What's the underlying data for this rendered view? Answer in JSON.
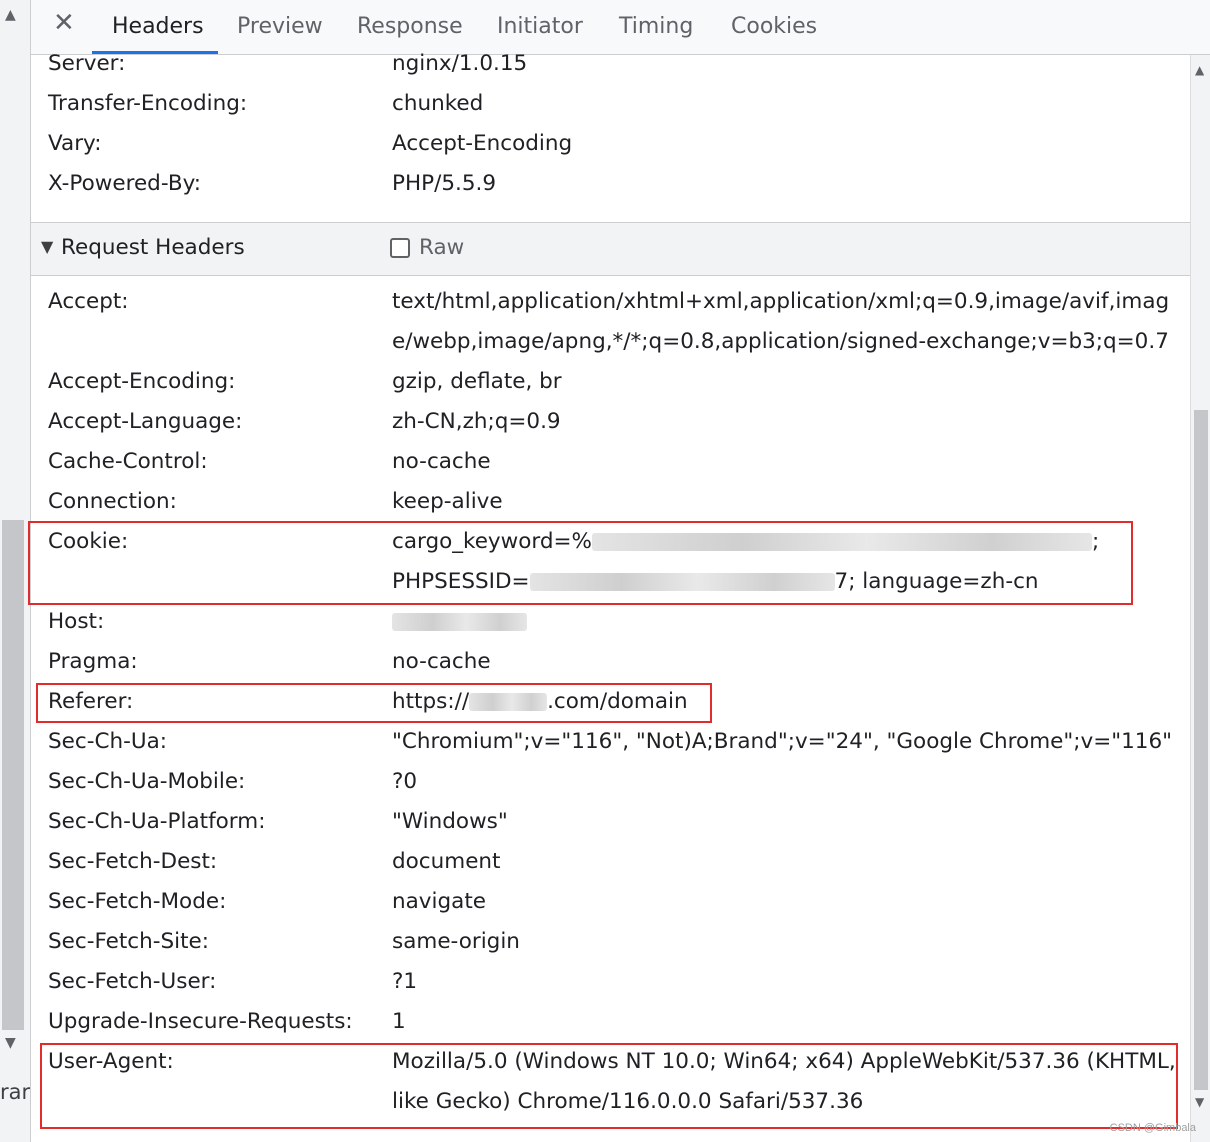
{
  "tabs": [
    {
      "label": "Headers",
      "active": true
    },
    {
      "label": "Preview"
    },
    {
      "label": "Response"
    },
    {
      "label": "Initiator"
    },
    {
      "label": "Timing"
    },
    {
      "label": "Cookies"
    }
  ],
  "left_fragment": "rar",
  "response_headers": [
    {
      "key": "Server:",
      "value": "nginx/1.0.15"
    },
    {
      "key": "Transfer-Encoding:",
      "value": "chunked"
    },
    {
      "key": "Vary:",
      "value": "Accept-Encoding"
    },
    {
      "key": "X-Powered-By:",
      "value": "PHP/5.5.9"
    }
  ],
  "request_section": {
    "title": "Request Headers",
    "raw_label": "Raw",
    "raw_checked": false
  },
  "request_headers": {
    "accept": {
      "key": "Accept:",
      "value": "text/html,application/xhtml+xml,application/xml;q=0.9,image/avif,image/webp,image/apng,*/*;q=0.8,application/signed-exchange;v=b3;q=0.7"
    },
    "accept_encoding": {
      "key": "Accept-Encoding:",
      "value": "gzip, deflate, br"
    },
    "accept_language": {
      "key": "Accept-Language:",
      "value": "zh-CN,zh;q=0.9"
    },
    "cache_control": {
      "key": "Cache-Control:",
      "value": "no-cache"
    },
    "connection": {
      "key": "Connection:",
      "value": "keep-alive"
    },
    "cookie": {
      "key": "Cookie:",
      "line1_prefix": "cargo_keyword=%",
      "line1_suffix": ";",
      "line2_prefix": "PHPSESSID=",
      "line2_suffix": "7; language=zh-cn"
    },
    "host": {
      "key": "Host:"
    },
    "pragma": {
      "key": "Pragma:",
      "value": "no-cache"
    },
    "referer": {
      "key": "Referer:",
      "prefix": "https://",
      "suffix": ".com/domain"
    },
    "sec_ch_ua": {
      "key": "Sec-Ch-Ua:",
      "value": "\"Chromium\";v=\"116\", \"Not)A;Brand\";v=\"24\", \"Google Chrome\";v=\"116\""
    },
    "sec_ch_ua_mobile": {
      "key": "Sec-Ch-Ua-Mobile:",
      "value": "?0"
    },
    "sec_ch_ua_platform": {
      "key": "Sec-Ch-Ua-Platform:",
      "value": "\"Windows\""
    },
    "sec_fetch_dest": {
      "key": "Sec-Fetch-Dest:",
      "value": "document"
    },
    "sec_fetch_mode": {
      "key": "Sec-Fetch-Mode:",
      "value": "navigate"
    },
    "sec_fetch_site": {
      "key": "Sec-Fetch-Site:",
      "value": "same-origin"
    },
    "sec_fetch_user": {
      "key": "Sec-Fetch-User:",
      "value": "?1"
    },
    "upgrade_insecure_requests": {
      "key": "Upgrade-Insecure-Requests:",
      "value": "1"
    },
    "user_agent": {
      "key": "User-Agent:",
      "value": "Mozilla/5.0 (Windows NT 10.0; Win64; x64) AppleWebKit/537.36 (KHTML, like Gecko) Chrome/116.0.0.0 Safari/537.36"
    }
  },
  "watermark": "CSDN @Gimbala",
  "colors": {
    "highlight": "#e22b2b",
    "active_tab": "#1a73e8"
  }
}
